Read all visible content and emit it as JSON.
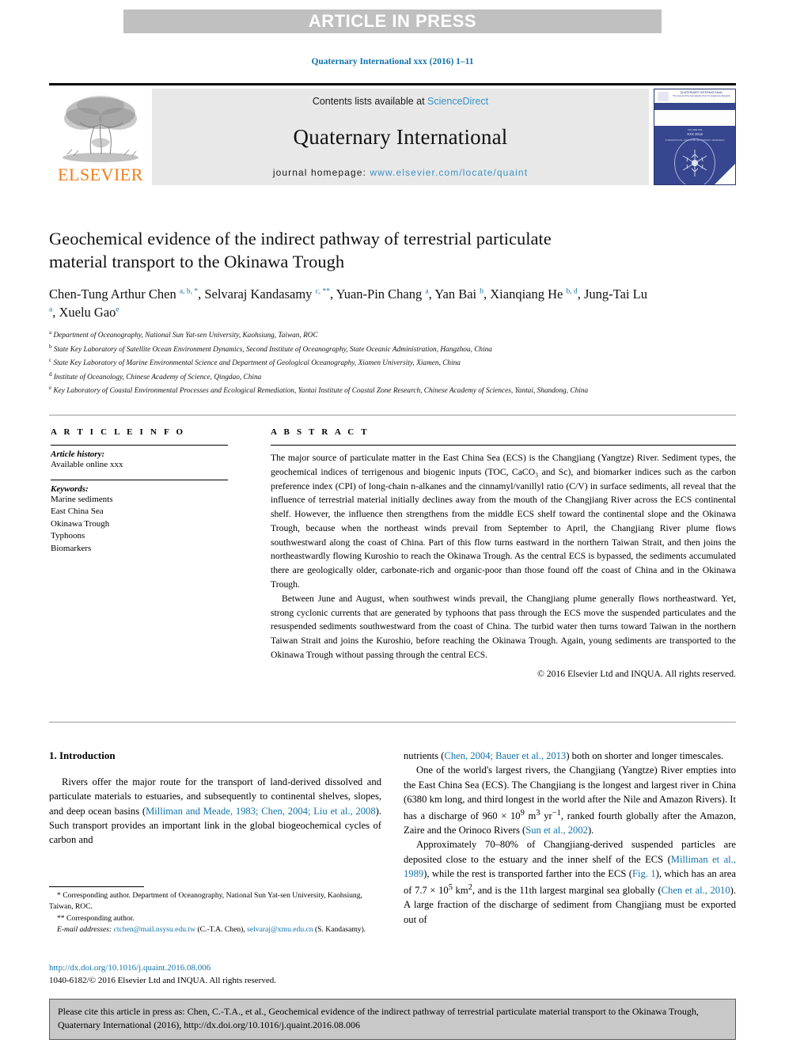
{
  "banner": {
    "text": "ARTICLE IN PRESS"
  },
  "running_head": "Quaternary International xxx (2016) 1–11",
  "journal_header": {
    "contents_prefix": "Contents lists available at ",
    "sciencedirect": "ScienceDirect",
    "journal_title": "Quaternary International",
    "homepage_prefix": "journal homepage: ",
    "homepage_url": "www.elsevier.com/locate/quaint",
    "publisher": "ELSEVIER",
    "cover_title": "QUATERNARY INTERNATIONAL",
    "cover_subtitle": "The Journal of the International Union for Quaternary Research",
    "cover_volume": "VOLUME 000",
    "cover_issue": "XXX 2016",
    "cover_society": "INTERNATIONAL UNION FOR QUATERNARY RESEARCH"
  },
  "article": {
    "title": "Geochemical evidence of the indirect pathway of terrestrial particulate material transport to the Okinawa Trough",
    "authors": [
      {
        "name": "Chen-Tung Arthur Chen",
        "marks": "a, b, *",
        "sep": ", "
      },
      {
        "name": "Selvaraj Kandasamy",
        "marks": "c, **",
        "sep": ", "
      },
      {
        "name": "Yuan-Pin Chang",
        "marks": "a",
        "sep": ", "
      },
      {
        "name": "Yan Bai",
        "marks": "b",
        "sep": ", "
      },
      {
        "name": "Xianqiang He",
        "marks": "b, d",
        "sep": ", "
      },
      {
        "name": "Jung-Tai Lu",
        "marks": "a",
        "sep": ", "
      },
      {
        "name": "Xuelu Gao",
        "marks": "e",
        "sep": ""
      }
    ],
    "affiliations": [
      {
        "mark": "a",
        "text": "Department of Oceanography, National Sun Yat-sen University, Kaohsiung, Taiwan, ROC"
      },
      {
        "mark": "b",
        "text": "State Key Laboratory of Satellite Ocean Environment Dynamics, Second Institute of Oceanography, State Oceanic Administration, Hangzhou, China"
      },
      {
        "mark": "c",
        "text": "State Key Laboratory of Marine Environmental Science and Department of Geological Oceanography, Xiamen University, Xiamen, China"
      },
      {
        "mark": "d",
        "text": "Institute of Oceanology, Chinese Academy of Science, Qingdao, China"
      },
      {
        "mark": "e",
        "text": "Key Laboratory of Coastal Environmental Processes and Ecological Remediation, Yantai Institute of Coastal Zone Research, Chinese Academy of Sciences, Yantai, Shandong, China"
      }
    ]
  },
  "article_info": {
    "heading": "A R T I C L E    I N F O",
    "history_label": "Article history:",
    "history_value": "Available online xxx",
    "keywords_label": "Keywords:",
    "keywords": [
      "Marine sediments",
      "East China Sea",
      "Okinawa Trough",
      "Typhoons",
      "Biomarkers"
    ]
  },
  "abstract": {
    "heading": "A B S T R A C T",
    "paragraph_1": "The major source of particulate matter in the East China Sea (ECS) is the Changjiang (Yangtze) River. Sediment types, the geochemical indices of terrigenous and biogenic inputs (TOC, CaCO₃ and Sc), and biomarker indices such as the carbon preference index (CPI) of long-chain n-alkanes and the cinnamyl/vanillyl ratio (C/V) in surface sediments, all reveal that the influence of terrestrial material initially declines away from the mouth of the Changjiang River across the ECS continental shelf. However, the influence then strengthens from the middle ECS shelf toward the continental slope and the Okinawa Trough, because when the northeast winds prevail from September to April, the Changjiang River plume flows southwestward along the coast of China. Part of this flow turns eastward in the northern Taiwan Strait, and then joins the northeastwardly flowing Kuroshio to reach the Okinawa Trough. As the central ECS is bypassed, the sediments accumulated there are geologically older, carbonate-rich and organic-poor than those found off the coast of China and in the Okinawa Trough.",
    "paragraph_2": "Between June and August, when southwest winds prevail, the Changjiang plume generally flows northeastward. Yet, strong cyclonic currents that are generated by typhoons that pass through the ECS move the suspended particulates and the resuspended sediments southwestward from the coast of China. The turbid water then turns toward Taiwan in the northern Taiwan Strait and joins the Kuroshio, before reaching the Okinawa Trough. Again, young sediments are transported to the Okinawa Trough without passing through the central ECS.",
    "copyright": "© 2016 Elsevier Ltd and INQUA. All rights reserved."
  },
  "body": {
    "section_heading": "1. Introduction",
    "left_p1_a": "Rivers offer the major route for the transport of land-derived dissolved and particulate materials to estuaries, and subsequently to continental shelves, slopes, and deep ocean basins (",
    "left_p1_ref1": "Milliman and Meade, 1983; Chen, 2004; Liu et al., 2008",
    "left_p1_b": "). Such transport provides an important link in the global biogeochemical cycles of carbon and",
    "right_p1_a": "nutrients (",
    "right_p1_ref1": "Chen, 2004; Bauer et al., 2013",
    "right_p1_b": ") both on shorter and longer timescales.",
    "right_p2_a": "One of the world's largest rivers, the Changjiang (Yangtze) River empties into the East China Sea (ECS). The Changjiang is the longest and largest river in China (6380 km long, and third longest in the world after the Nile and Amazon Rivers). It has a discharge of 960 × 10",
    "right_p2_sup1": "9",
    "right_p2_b": " m",
    "right_p2_sup2": "3",
    "right_p2_c": " yr",
    "right_p2_sup3": "−1",
    "right_p2_d": ", ranked fourth globally after the Amazon, Zaire and the Orinoco Rivers (",
    "right_p2_ref1": "Sun et al., 2002",
    "right_p2_e": ").",
    "right_p3_a": "Approximately 70–80% of Changjiang-derived suspended particles are deposited close to the estuary and the inner shelf of the ECS (",
    "right_p3_ref1": "Milliman et al., 1989",
    "right_p3_b": "), while the rest is transported farther into the ECS (",
    "right_p3_ref2": "Fig. 1",
    "right_p3_c": "), which has an area of 7.7 × 10",
    "right_p3_sup1": "5",
    "right_p3_d": " km",
    "right_p3_sup2": "2",
    "right_p3_e": ", and is the 11th largest marginal sea globally (",
    "right_p3_ref3": "Chen et al., 2010",
    "right_p3_f": "). A large fraction of the discharge of sediment from Changjiang must be exported out of"
  },
  "footnotes": {
    "fn1_mark": "*",
    "fn1_text": "Corresponding author. Department of Oceanography, National Sun Yat-sen University, Kaohsiung, Taiwan, ROC.",
    "fn2_mark": "**",
    "fn2_text": "Corresponding author.",
    "email_label": "E-mail addresses:",
    "email_1": "ctchen@mail.nsysu.edu.tw",
    "email_1_owner": "(C.-T.A. Chen)",
    "email_2": "selvaraj@xmu.edu.cn",
    "email_2_owner": "(S. Kandasamy)."
  },
  "doi_block": {
    "doi_url": "http://dx.doi.org/10.1016/j.quaint.2016.08.006",
    "issn_line": "1040-6182/© 2016 Elsevier Ltd and INQUA. All rights reserved."
  },
  "cite_footer": {
    "text": "Please cite this article in press as: Chen, C.-T.A., et al., Geochemical evidence of the indirect pathway of terrestrial particulate material transport to the Okinawa Trough, Quaternary International (2016), http://dx.doi.org/10.1016/j.quaint.2016.08.006"
  },
  "colors": {
    "link_blue": "#1273a9",
    "sciencedirect_blue": "#3a93c6",
    "elsevier_orange": "#ef7d1a",
    "banner_gray": "#c0c0c0",
    "header_gray": "#e8e8e8",
    "cover_navy": "#36468f",
    "cite_gray": "#c8c8c8"
  }
}
